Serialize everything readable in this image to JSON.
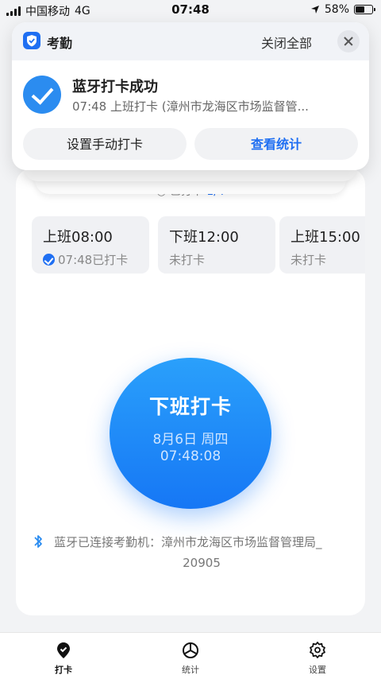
{
  "status_bar": {
    "carrier": "中国移动",
    "network": "4G",
    "time": "07:48",
    "battery": "58%",
    "battery_level": 0.58
  },
  "notification": {
    "app_name": "考勤",
    "close_all": "关闭全部",
    "title": "蓝牙打卡成功",
    "body": "07:48 上班打卡 (漳州市龙海区市场监督管...",
    "buttons": [
      "设置手动打卡",
      "查看统计"
    ]
  },
  "main": {
    "progress_prefix": "已打卡 ",
    "progress_value": "1/4",
    "shifts": [
      {
        "title": "上班08:00",
        "status": "07:48已打卡",
        "done": true
      },
      {
        "title": "下班12:00",
        "status": "未打卡",
        "done": false
      },
      {
        "title": "上班15:00",
        "status": "未打卡",
        "done": false
      }
    ],
    "punch": {
      "title": "下班打卡",
      "date": "8月6日 周四",
      "time": "07:48:08"
    },
    "bluetooth": {
      "line1": "蓝牙已连接考勤机：漳州市龙海区市场监督管理局_",
      "line2": "20905"
    }
  },
  "tabbar": {
    "items": [
      {
        "label": "打卡",
        "icon": "punch-check-icon",
        "active": true
      },
      {
        "label": "统计",
        "icon": "pie-chart-icon",
        "active": false
      },
      {
        "label": "设置",
        "icon": "gear-icon",
        "active": false
      }
    ]
  },
  "colors": {
    "accent": "#1f6ff2",
    "punch_gradient_top": "#2aa0fb",
    "punch_gradient_bottom": "#1677f5"
  }
}
